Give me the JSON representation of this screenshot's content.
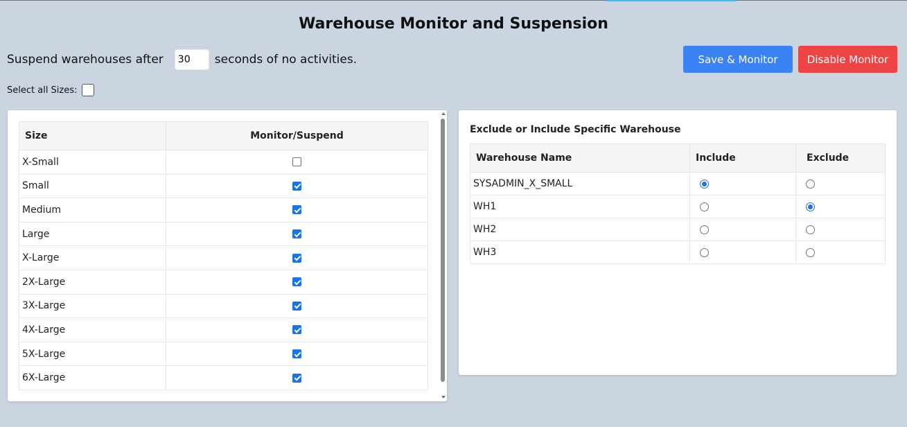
{
  "title": "Warehouse Monitor and Suspension",
  "suspend": {
    "prefix": "Suspend warehouses after",
    "value": "30",
    "suffix": "seconds of no activities."
  },
  "buttons": {
    "save": "Save & Monitor",
    "disable": "Disable Monitor"
  },
  "select_all": {
    "label": "Select all Sizes:",
    "checked": false
  },
  "sizes": {
    "headers": [
      "Size",
      "Monitor/Suspend"
    ],
    "rows": [
      {
        "label": "X-Small",
        "checked": false
      },
      {
        "label": "Small",
        "checked": true
      },
      {
        "label": "Medium",
        "checked": true
      },
      {
        "label": "Large",
        "checked": true
      },
      {
        "label": "X-Large",
        "checked": true
      },
      {
        "label": "2X-Large",
        "checked": true
      },
      {
        "label": "3X-Large",
        "checked": true
      },
      {
        "label": "4X-Large",
        "checked": true
      },
      {
        "label": "5X-Large",
        "checked": true
      },
      {
        "label": "6X-Large",
        "checked": true
      }
    ]
  },
  "warehouses": {
    "title": "Exclude or Include Specific Warehouse",
    "headers": [
      "Warehouse Name",
      "Include",
      "Exclude"
    ],
    "rows": [
      {
        "name": "SYSADMIN_X_SMALL",
        "selection": "include"
      },
      {
        "name": "WH1",
        "selection": "exclude"
      },
      {
        "name": "WH2",
        "selection": "none"
      },
      {
        "name": "WH3",
        "selection": "none"
      }
    ]
  },
  "colors": {
    "background": "#cbd5e1",
    "primary": "#3b82f6",
    "danger": "#ef4444",
    "checkbox": "#1a73e8"
  }
}
